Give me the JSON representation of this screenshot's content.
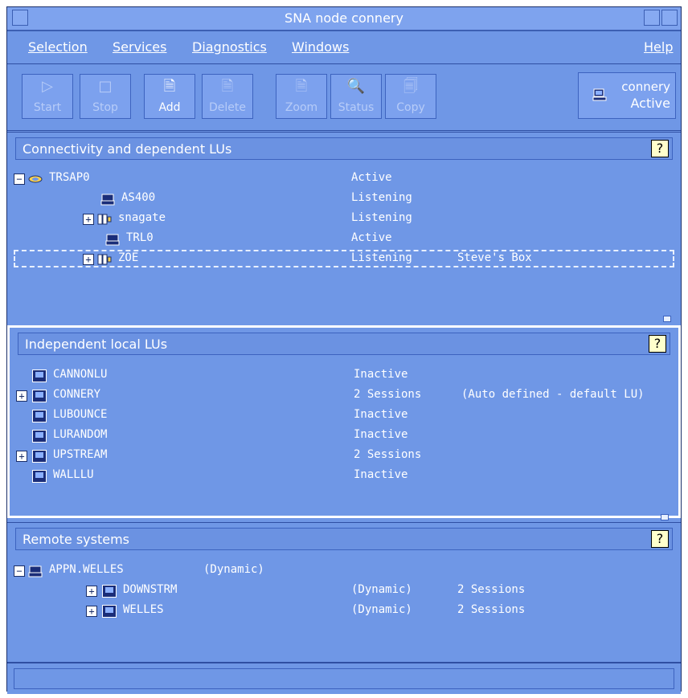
{
  "window": {
    "title": "SNA node connery"
  },
  "menu": {
    "items": [
      {
        "label": "Selection"
      },
      {
        "label": "Services"
      },
      {
        "label": "Diagnostics"
      },
      {
        "label": "Windows"
      },
      {
        "label": "Help"
      }
    ]
  },
  "toolbar": {
    "buttons": [
      {
        "label": "Start",
        "disabled": true,
        "icon": "play-icon"
      },
      {
        "label": "Stop",
        "disabled": true,
        "icon": "stop-icon"
      },
      {
        "label": "Add",
        "disabled": false,
        "icon": "add-icon"
      },
      {
        "label": "Delete",
        "disabled": true,
        "icon": "delete-icon"
      },
      {
        "label": "Zoom",
        "disabled": true,
        "icon": "zoom-icon"
      },
      {
        "label": "Status",
        "disabled": true,
        "icon": "status-icon"
      },
      {
        "label": "Copy",
        "disabled": true,
        "icon": "copy-icon"
      }
    ],
    "node_status": {
      "name": "connery",
      "state": "Active"
    }
  },
  "panels": [
    {
      "title": "Connectivity and dependent LUs",
      "rows": [
        {
          "name": "TRSAP0",
          "status": "Active",
          "note": "",
          "icon": "port-icon",
          "expander": "−"
        },
        {
          "name": "AS400",
          "status": "Listening",
          "note": "",
          "icon": "computer-icon",
          "expander": ""
        },
        {
          "name": "snagate",
          "status": "Listening",
          "note": "",
          "icon": "chain-icon",
          "expander": "+"
        },
        {
          "name": "TRL0",
          "status": "Active",
          "note": "",
          "icon": "computer-icon",
          "expander": ""
        },
        {
          "name": "ZOE",
          "status": "Listening",
          "note": "Steve's Box",
          "icon": "chain-icon",
          "expander": "+"
        }
      ]
    },
    {
      "title": "Independent local LUs",
      "rows": [
        {
          "name": "CANNONLU",
          "status": "Inactive",
          "note": "",
          "icon": "monitor-icon",
          "expander": ""
        },
        {
          "name": "CONNERY",
          "status": "2 Sessions",
          "note": "(Auto defined - default LU)",
          "icon": "monitor-icon",
          "expander": "+"
        },
        {
          "name": "LUBOUNCE",
          "status": "Inactive",
          "note": "",
          "icon": "monitor-icon",
          "expander": ""
        },
        {
          "name": "LURANDOM",
          "status": "Inactive",
          "note": "",
          "icon": "monitor-icon",
          "expander": ""
        },
        {
          "name": "UPSTREAM",
          "status": "2 Sessions",
          "note": "",
          "icon": "monitor-icon",
          "expander": "+"
        },
        {
          "name": "WALLLU",
          "status": "Inactive",
          "note": "",
          "icon": "monitor-icon",
          "expander": ""
        }
      ]
    },
    {
      "title": "Remote systems",
      "rows": [
        {
          "name": "APPN.WELLES",
          "status": "",
          "note": "(Dynamic)",
          "icon": "computer-icon",
          "expander": "−"
        },
        {
          "name": "DOWNSTRM",
          "status": "(Dynamic)",
          "note": "2 Sessions",
          "icon": "monitor-icon",
          "expander": "+"
        },
        {
          "name": "WELLES",
          "status": "(Dynamic)",
          "note": "2 Sessions",
          "icon": "monitor-icon",
          "expander": "+"
        }
      ]
    }
  ]
}
